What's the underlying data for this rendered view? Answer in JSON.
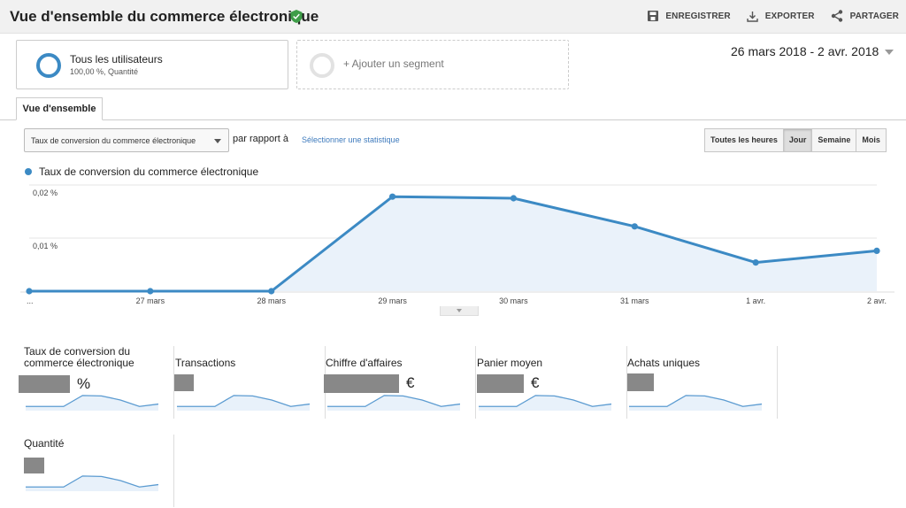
{
  "header": {
    "title": "Vue d'ensemble du commerce électronique",
    "actions": {
      "save": "ENREGISTRER",
      "export": "EXPORTER",
      "share": "PARTAGER"
    }
  },
  "segments": {
    "primary": {
      "name": "Tous les utilisateurs",
      "detail": "100,00 %, Quantité"
    },
    "add_label": "+ Ajouter un segment"
  },
  "date_range": "26 mars 2018 - 2 avr. 2018",
  "tabs": {
    "overview": "Vue d'ensemble"
  },
  "controls": {
    "metric_select": "Taux de conversion du commerce électronique",
    "compare_label": "par rapport à",
    "select_metric_link": "Sélectionner une statistique",
    "granularity": [
      {
        "label": "Toutes les heures",
        "active": false
      },
      {
        "label": "Jour",
        "active": true
      },
      {
        "label": "Semaine",
        "active": false
      },
      {
        "label": "Mois",
        "active": false
      }
    ]
  },
  "chart_data": {
    "type": "area",
    "series": [
      {
        "name": "Taux de conversion du commerce électronique",
        "values": [
          0,
          0,
          0,
          0.0178,
          0.0175,
          0.0122,
          0.0054,
          0.0076
        ]
      }
    ],
    "categories": [
      "...",
      "27 mars",
      "28 mars",
      "29 mars",
      "30 mars",
      "31 mars",
      "1 avr.",
      "2 avr."
    ],
    "y_ticks": [
      "0,02 %",
      "0,01 %"
    ],
    "ylim": [
      0,
      0.02
    ],
    "grid": true,
    "color": "#3c8ac4"
  },
  "metrics": [
    {
      "label": "Taux de conversion du commerce électronique",
      "unit": "%"
    },
    {
      "label": "Transactions",
      "unit": ""
    },
    {
      "label": "Chiffre d'affaires",
      "unit": "€"
    },
    {
      "label": "Panier moyen",
      "unit": "€"
    },
    {
      "label": "Achats uniques",
      "unit": ""
    },
    {
      "label": "Quantité",
      "unit": ""
    }
  ]
}
